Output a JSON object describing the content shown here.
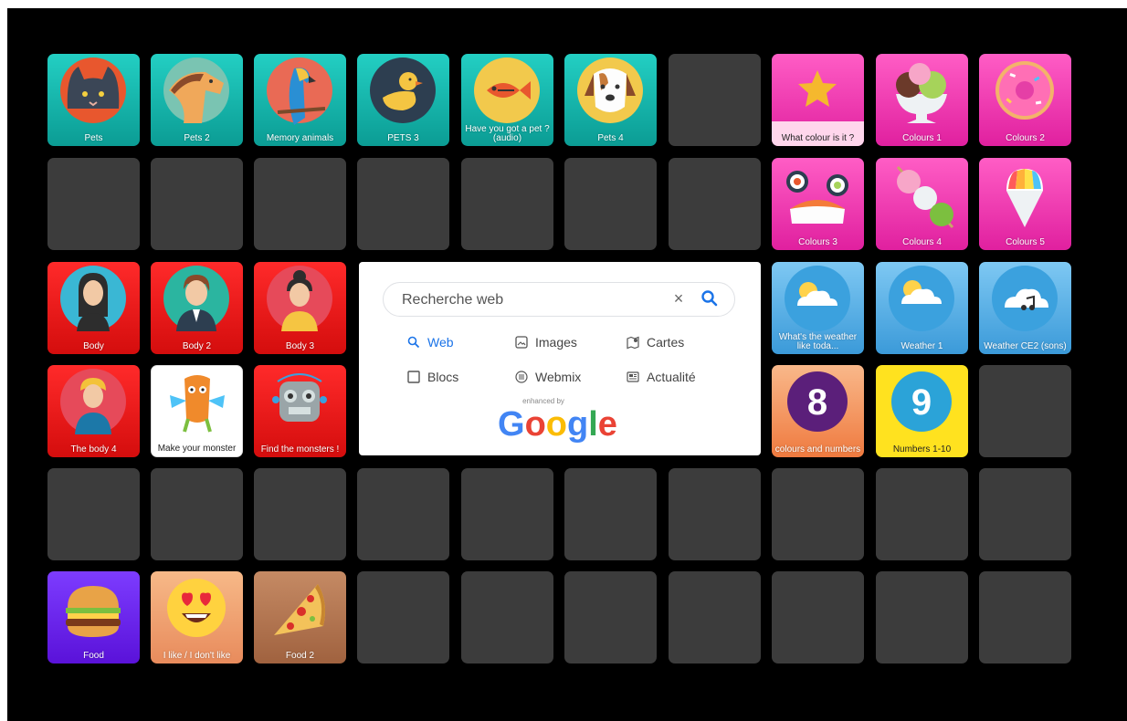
{
  "tiles": {
    "pets": "Pets",
    "pets2": "Pets 2",
    "memory_animals": "Memory animals",
    "pets3": "PETS 3",
    "have_pet": "Have you got a pet ? (audio)",
    "pets4": "Pets 4",
    "what_colour": "What colour is it ?",
    "colours1": "Colours 1",
    "colours2": "Colours 2",
    "colours3": "Colours 3",
    "colours4": "Colours 4",
    "colours5": "Colours 5",
    "body": "Body",
    "body2": "Body 2",
    "body3": "Body 3",
    "weather_today": "What's the weather like toda...",
    "weather1": "Weather 1",
    "weather_ce2": "Weather CE2 (sons)",
    "body4": "The body 4",
    "make_monster": "Make your monster",
    "find_monsters": "Find the monsters !",
    "colours_numbers": "colours and numbers",
    "numbers": "Numbers 1-10",
    "food": "Food",
    "i_like": "I like / I don't like",
    "food2": "Food 2"
  },
  "badges": {
    "eight": "8",
    "nine": "9"
  },
  "search": {
    "placeholder": "Recherche web",
    "clear_glyph": "×",
    "options": {
      "web": "Web",
      "images": "Images",
      "cartes": "Cartes",
      "blocs": "Blocs",
      "webmix": "Webmix",
      "actualite": "Actualité"
    },
    "enhanced_by": "enhanced by",
    "logo": "Google"
  },
  "colors": {
    "background": "#000000",
    "empty_tile": "#3c3c3c",
    "teal": "#14b5ab",
    "pink": "#f03bb3",
    "red": "#ea1b1b",
    "blue": "#5cb1e6",
    "accent_link": "#1a73e8"
  }
}
